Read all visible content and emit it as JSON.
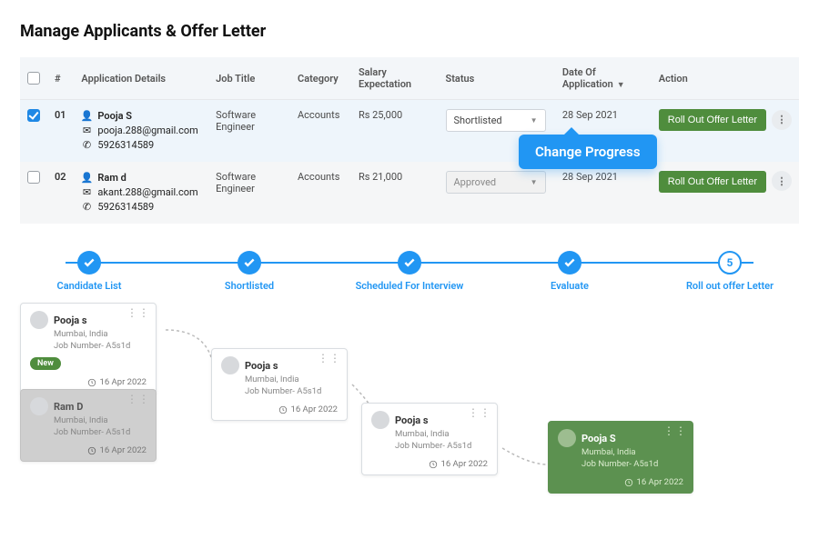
{
  "page": {
    "title": "Manage Applicants & Offer Letter"
  },
  "table": {
    "headers": {
      "num": "#",
      "details": "Application Details",
      "job": "Job Title",
      "category": "Category",
      "salary": "Salary Expectation",
      "status": "Status",
      "date": "Date Of Application",
      "action": "Action"
    },
    "rows": [
      {
        "index": "01",
        "checked": true,
        "name": "Pooja S",
        "email": "pooja.288@gmail.com",
        "phone": "5926314589",
        "job": "Software Engineer",
        "category": "Accounts",
        "salary": "Rs 25,000",
        "status": "Shortlisted",
        "date": "28 Sep 2021",
        "action": "Roll Out Offer Letter"
      },
      {
        "index": "02",
        "checked": false,
        "name": "Ram d",
        "email": "akant.288@gmail.com",
        "phone": "5926314589",
        "job": "Software Engineer",
        "category": "Accounts",
        "salary": "Rs 21,000",
        "status": "Approved",
        "date": "28 Sep 2021",
        "action": "Roll Out Offer Letter"
      }
    ]
  },
  "tooltip": {
    "text": "Change Progress"
  },
  "stepper": {
    "steps": [
      {
        "label": "Candidate List",
        "state": "done"
      },
      {
        "label": "Shortlisted",
        "state": "done"
      },
      {
        "label": "Scheduled For Interview",
        "state": "done"
      },
      {
        "label": "Evaluate",
        "state": "done"
      },
      {
        "label": "Roll out offer Letter",
        "state": "pending",
        "num": "5"
      }
    ]
  },
  "cards": [
    {
      "id": "c1",
      "name": "Pooja s",
      "location": "Mumbai, India",
      "job": "Job Number- A5s1d",
      "date": "16 Apr 2022",
      "badge": "New",
      "variant": "white"
    },
    {
      "id": "c2",
      "name": "Ram D",
      "location": "Mumbai, India",
      "job": "Job Number- A5s1d",
      "date": "16 Apr 2022",
      "variant": "shadow"
    },
    {
      "id": "c3",
      "name": "Pooja s",
      "location": "Mumbai, India",
      "job": "Job Number- A5s1d",
      "date": "16 Apr 2022",
      "variant": "white"
    },
    {
      "id": "c4",
      "name": "Pooja s",
      "location": "Mumbai, India",
      "job": "Job Number- A5s1d",
      "date": "16 Apr 2022",
      "variant": "white"
    },
    {
      "id": "c5",
      "name": "Pooja S",
      "location": "Mumbai, India",
      "job": "Job Number- A5s1d",
      "date": "16 Apr 2022",
      "variant": "green"
    }
  ]
}
